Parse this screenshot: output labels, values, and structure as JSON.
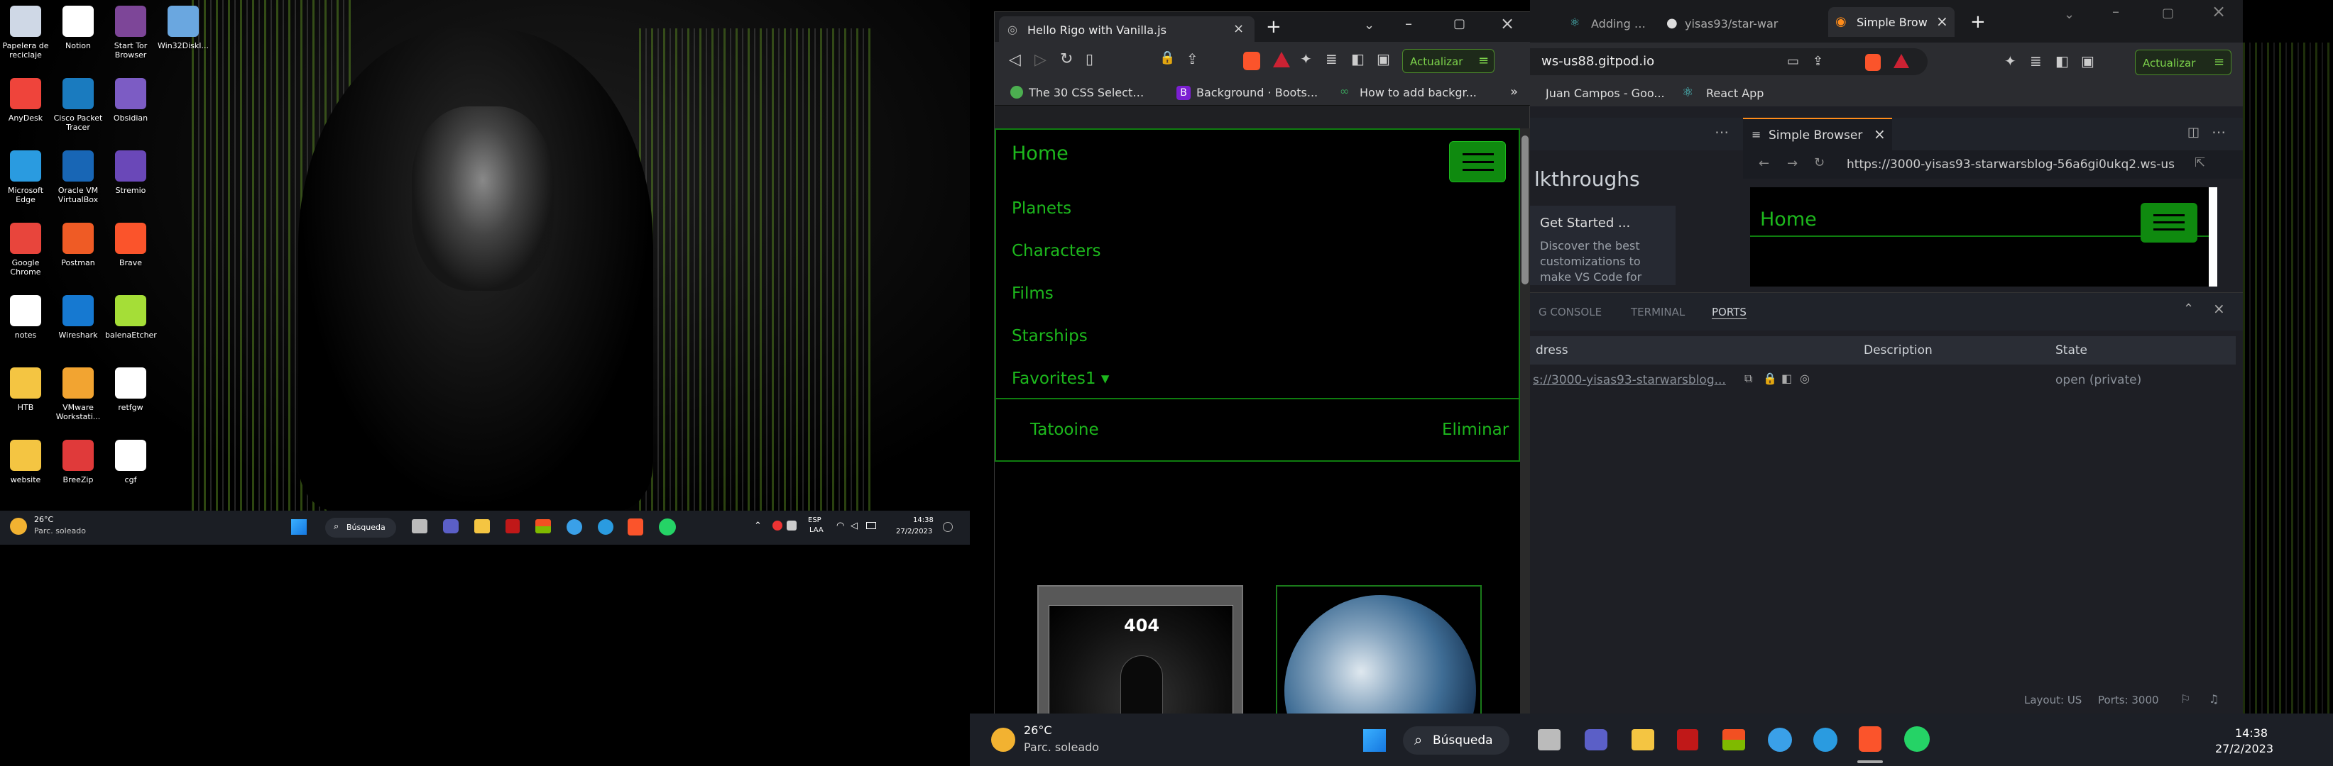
{
  "desktop1": {
    "icons": [
      {
        "label": "Papelera de reciclaje",
        "icon": "recycle-bin-icon",
        "color": "#cfd8e6"
      },
      {
        "label": "Notion",
        "icon": "notion-icon",
        "color": "#ffffff"
      },
      {
        "label": "Start Tor Browser",
        "icon": "tor-icon",
        "color": "#7d4698"
      },
      {
        "label": "Win32DiskI...",
        "icon": "disk-imager-icon",
        "color": "#6aa7e0"
      },
      {
        "label": "AnyDesk",
        "icon": "anydesk-icon",
        "color": "#ef443b"
      },
      {
        "label": "Cisco Packet Tracer",
        "icon": "packet-tracer-icon",
        "color": "#1a7bbf"
      },
      {
        "label": "Obsidian",
        "icon": "obsidian-icon",
        "color": "#7c5cc4"
      },
      {
        "label": "Microsoft Edge",
        "icon": "edge-icon",
        "color": "#2a9be0"
      },
      {
        "label": "Oracle VM VirtualBox",
        "icon": "virtualbox-icon",
        "color": "#1866b5"
      },
      {
        "label": "Stremio",
        "icon": "stremio-icon",
        "color": "#6a48b8"
      },
      {
        "label": "Google Chrome",
        "icon": "chrome-icon",
        "color": "#e8453c"
      },
      {
        "label": "Postman",
        "icon": "postman-icon",
        "color": "#ef5b25"
      },
      {
        "label": "Brave",
        "icon": "brave-icon",
        "color": "#fb542b"
      },
      {
        "label": "notes",
        "icon": "text-file-icon",
        "color": "#ffffff"
      },
      {
        "label": "Wireshark",
        "icon": "wireshark-icon",
        "color": "#1679d1"
      },
      {
        "label": "balenaEtcher",
        "icon": "etcher-icon",
        "color": "#a5de37"
      },
      {
        "label": "HTB",
        "icon": "folder-icon",
        "color": "#f4c542"
      },
      {
        "label": "VMware Workstati...",
        "icon": "vmware-icon",
        "color": "#f2a431"
      },
      {
        "label": "retfgw",
        "icon": "text-file-icon",
        "color": "#ffffff"
      },
      {
        "label": "website",
        "icon": "folder-icon",
        "color": "#f4c542"
      },
      {
        "label": "BreeZip",
        "icon": "breezip-icon",
        "color": "#e03a3a"
      },
      {
        "label": "cgf",
        "icon": "file-icon",
        "color": "#ffffff"
      }
    ],
    "taskbar": {
      "weather_temp": "26°C",
      "weather_desc": "Parc. soleado",
      "search": "Búsqueda",
      "lang1": "ESP",
      "lang2": "LAA",
      "time": "14:38",
      "date": "27/2/2023"
    }
  },
  "browser1": {
    "tab_title": "Hello Rigo with Vanilla.js",
    "update_btn": "Actualizar",
    "bookmarks": [
      "The 30 CSS Selector...",
      "Background · Boots...",
      "How to add backgr..."
    ],
    "site": {
      "brand": "Home",
      "nav": [
        "Planets",
        "Characters",
        "Films",
        "Starships",
        "Favorites1 ▾"
      ],
      "favorite_item": "Tatooine",
      "favorite_action": "Eliminar",
      "card1_text": "404"
    }
  },
  "browser2": {
    "tabs": [
      "Adding Images,",
      "yisas93/star-war",
      "Simple Brow"
    ],
    "address": "ws-us88.gitpod.io",
    "update_btn": "Actualizar",
    "bookmarks": [
      "Juan Campos - Goo...",
      "React App"
    ],
    "vscode": {
      "simple_browser_tab": "Simple Browser",
      "walkthroughs": "lkthroughs",
      "get_started_title": "Get Started ...",
      "get_started_desc": "Discover the best customizations to make VS Code for",
      "sb_url": "https://3000-yisas93-starwarsblog-56a6gi0ukq2.ws-us",
      "sb_home": "Home",
      "panel_tabs": [
        "G CONSOLE",
        "TERMINAL",
        "PORTS"
      ],
      "ports_headers": [
        "dress",
        "Description",
        "State"
      ],
      "port_address": "s://3000-yisas93-starwarsblog...",
      "port_state": "open (private)",
      "status_layout": "Layout: US",
      "status_ports": "Ports: 3000"
    }
  },
  "taskbar2": {
    "weather_temp": "26°C",
    "weather_desc": "Parc. soleado",
    "search": "Búsqueda",
    "time": "14:38",
    "date": "27/2/2023"
  }
}
